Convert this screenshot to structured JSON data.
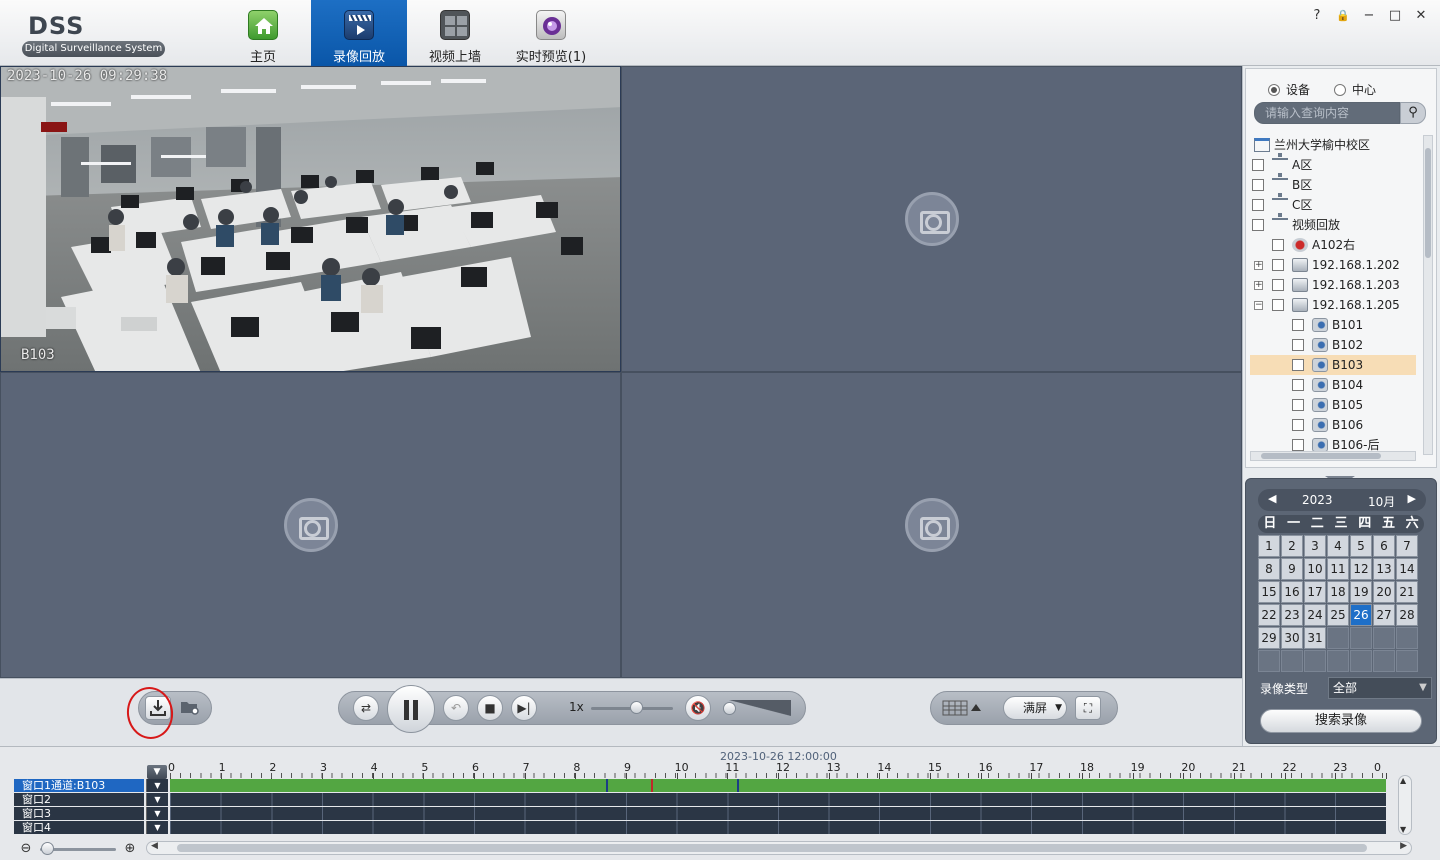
{
  "app": {
    "logo_title": "DSS",
    "logo_subtitle": "Digital Surveillance System",
    "nav": [
      {
        "label": "主页",
        "icon": "home-icon",
        "color": "#4aa43c"
      },
      {
        "label": "录像回放",
        "icon": "playback-clapper-icon",
        "color": "#2b5f9e"
      },
      {
        "label": "视频上墙",
        "icon": "video-wall-icon",
        "color": "#5a5a5a"
      },
      {
        "label": "实时预览(1)",
        "icon": "live-camera-icon",
        "color": "#7b3ea6"
      }
    ],
    "active_nav": 1,
    "window_controls": [
      "?",
      "🔒",
      "−",
      "□",
      "✕"
    ]
  },
  "video": {
    "pane1": {
      "timestamp": "2023-10-26 09:29:38",
      "channel_name": "B103"
    }
  },
  "tree_panel": {
    "mode_options": [
      "设备",
      "中心"
    ],
    "mode_selected": 0,
    "search_placeholder": "请输入查询内容",
    "nodes": [
      {
        "label": "兰州大学榆中校区",
        "level": 0,
        "icon": "root",
        "checkbox": false,
        "expander": null
      },
      {
        "label": "A区",
        "level": 0,
        "icon": "net",
        "checkbox": true,
        "expander": null
      },
      {
        "label": "B区",
        "level": 0,
        "icon": "net",
        "checkbox": true,
        "expander": null
      },
      {
        "label": "C区",
        "level": 0,
        "icon": "net",
        "checkbox": true,
        "expander": null
      },
      {
        "label": "视频回放",
        "level": 0,
        "icon": "net",
        "checkbox": true,
        "expander": null
      },
      {
        "label": "A102右",
        "level": 1,
        "icon": "fail",
        "checkbox": true,
        "expander": null
      },
      {
        "label": "192.168.1.202",
        "level": 1,
        "icon": "dvr",
        "checkbox": true,
        "expander": "+"
      },
      {
        "label": "192.168.1.203",
        "level": 1,
        "icon": "dvr",
        "checkbox": true,
        "expander": "+"
      },
      {
        "label": "192.168.1.205",
        "level": 1,
        "icon": "dvr",
        "checkbox": true,
        "expander": "−"
      },
      {
        "label": "B101",
        "level": 2,
        "icon": "cam",
        "checkbox": true,
        "expander": null
      },
      {
        "label": "B102",
        "level": 2,
        "icon": "cam",
        "checkbox": true,
        "expander": null
      },
      {
        "label": "B103",
        "level": 2,
        "icon": "cam",
        "checkbox": true,
        "expander": null,
        "selected": true
      },
      {
        "label": "B104",
        "level": 2,
        "icon": "cam",
        "checkbox": true,
        "expander": null
      },
      {
        "label": "B105",
        "level": 2,
        "icon": "cam",
        "checkbox": true,
        "expander": null
      },
      {
        "label": "B106",
        "level": 2,
        "icon": "cam",
        "checkbox": true,
        "expander": null
      },
      {
        "label": "B106-后",
        "level": 2,
        "icon": "cam",
        "checkbox": true,
        "expander": null
      }
    ]
  },
  "calendar": {
    "year": "2023",
    "month": "10月",
    "prev": "◀",
    "next": "▶",
    "weekdays": [
      "日",
      "一",
      "二",
      "三",
      "四",
      "五",
      "六"
    ],
    "days": [
      "1",
      "2",
      "3",
      "4",
      "5",
      "6",
      "7",
      "8",
      "9",
      "10",
      "11",
      "12",
      "13",
      "14",
      "15",
      "16",
      "17",
      "18",
      "19",
      "20",
      "21",
      "22",
      "23",
      "24",
      "25",
      "26",
      "27",
      "28",
      "29",
      "30",
      "31"
    ],
    "first_weekday": 0,
    "today": "26",
    "record_type_label": "录像类型",
    "record_type_value": "全部",
    "search_button": "搜索录像"
  },
  "controls": {
    "speed": "1x",
    "speed_fraction": 0.55,
    "volume_fraction": 0.0,
    "screen_mode": "满屏",
    "icons": [
      "download-icon",
      "folder-settings-icon",
      "shuffle-icon",
      "pause-icon",
      "undo-icon",
      "stop-icon",
      "step-forward-icon",
      "mute-icon",
      "grid-layout-icon",
      "fullscreen-icon"
    ]
  },
  "timeline": {
    "date": "2023-10-26 12:00:00",
    "hours": [
      "0",
      "1",
      "2",
      "3",
      "4",
      "5",
      "6",
      "7",
      "8",
      "9",
      "10",
      "11",
      "12",
      "13",
      "14",
      "15",
      "16",
      "17",
      "18",
      "19",
      "20",
      "21",
      "22",
      "23",
      "0"
    ],
    "tracks": [
      {
        "label": "窗口1通道:B103",
        "recorded": true,
        "active": true
      },
      {
        "label": "窗口2",
        "recorded": false,
        "active": false
      },
      {
        "label": "窗口3",
        "recorded": false,
        "active": false
      },
      {
        "label": "窗口4",
        "recorded": false,
        "active": false
      }
    ],
    "markers_hours": [
      {
        "hour": 8.6,
        "color": "#1c3e86"
      },
      {
        "hour": 9.5,
        "color": "#c0282a"
      },
      {
        "hour": 11.2,
        "color": "#1c3e86"
      }
    ],
    "colors": {
      "recorded": "#53a642",
      "empty": "#2b3645"
    }
  }
}
